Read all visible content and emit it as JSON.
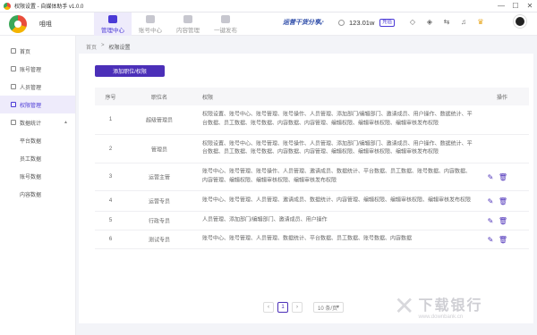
{
  "window": {
    "title": "权限设置 - 自媒体助手 v1.0.0",
    "controls": [
      "—",
      "☐",
      "✕"
    ]
  },
  "header": {
    "brand": "咀咀",
    "nav": [
      {
        "label": "管理中心"
      },
      {
        "label": "账号中心"
      },
      {
        "label": "内容管理"
      },
      {
        "label": "一键发布"
      }
    ],
    "promo": "运营干货分享",
    "balance": "123.01w",
    "balance_badge": "充值"
  },
  "sidebar": {
    "items": [
      {
        "label": "首页"
      },
      {
        "label": "账号管理"
      },
      {
        "label": "人员管理"
      },
      {
        "label": "权限管理"
      },
      {
        "label": "数据统计"
      }
    ],
    "subitems": [
      {
        "label": "平台数据"
      },
      {
        "label": "员工数据"
      },
      {
        "label": "账号数据"
      },
      {
        "label": "内容数据"
      }
    ]
  },
  "breadcrumb": {
    "home": "首页",
    "sep": ">",
    "current": "权限设置"
  },
  "main": {
    "add_button": "添加职位/权限",
    "columns": {
      "no": "序号",
      "name": "职位名",
      "perm": "权限",
      "op": "操作"
    },
    "rows": [
      {
        "no": "1",
        "name": "超级管理员",
        "perm": "权限设置、账号中心、账号管理、账号操作、人员管理、添加部门/编辑部门、邀请成员、用户操作、数据统计、平台数据、员工数据、账号数据、内容数据、内容管理、编辑权限、编辑审核权限、编辑审核发布权限"
      },
      {
        "no": "2",
        "name": "管理员",
        "perm": "权限设置、账号中心、账号管理、账号操作、人员管理、添加部门/编辑部门、邀请成员、用户操作、数据统计、平台数据、员工数据、账号数据、内容数据、内容管理、编辑权限、编辑审核权限、编辑审核发布权限"
      },
      {
        "no": "3",
        "name": "运营主管",
        "perm": "账号中心、账号管理、账号操作、人员管理、邀请成员、数据统计、平台数据、员工数据、账号数据、内容数据、内容管理、编辑权限、编辑审核权限、编辑审核发布权限"
      },
      {
        "no": "4",
        "name": "运营专员",
        "perm": "账号中心、账号管理、人员管理、邀请成员、数据统计、内容管理、编辑权限、编辑审核权限、编辑审核发布权限"
      },
      {
        "no": "5",
        "name": "行政专员",
        "perm": "人员管理、添加部门/编辑部门、邀请成员、用户操作"
      },
      {
        "no": "6",
        "name": "测试专员",
        "perm": "账号中心、账号管理、人员管理、数据统计、平台数据、员工数据、账号数据、内容数据"
      }
    ]
  },
  "pager": {
    "prev": "‹",
    "page": "1",
    "next": "›",
    "size": "10 条/页"
  },
  "watermark": {
    "text": "下载银行",
    "url": "www.downbank.cn"
  }
}
